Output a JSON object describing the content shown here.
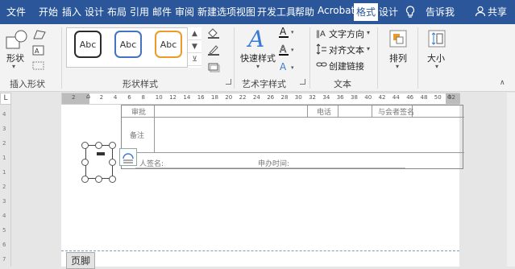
{
  "tabs": [
    "文件",
    "开始",
    "插入",
    "设计",
    "布局",
    "引用",
    "邮件",
    "审阅",
    "新建选项",
    "视图",
    "开发工具",
    "帮助",
    "Acrobat",
    "格式",
    "设计"
  ],
  "active_tab_index": 13,
  "tell_me": "告诉我",
  "share": "共享",
  "groups": {
    "insert_shapes": {
      "label": "插入形状",
      "shapes_btn": "形状"
    },
    "shape_styles": {
      "label": "形状样式",
      "sample": "Abc"
    },
    "wordart": {
      "label": "艺术字样式",
      "quick_styles": "快速样式"
    },
    "text": {
      "label": "文本",
      "direction": "文字方向",
      "align": "对齐文本",
      "link": "创建链接"
    },
    "arrange": {
      "label": "排列"
    },
    "size": {
      "label": "大小"
    }
  },
  "ruler_ticks": [
    "2",
    "",
    "2",
    "4",
    "6",
    "8",
    "10",
    "12",
    "14",
    "16",
    "18",
    "20",
    "22",
    "24",
    "26",
    "28",
    "30",
    "32",
    "34",
    "36",
    "38",
    "40",
    "42",
    "44",
    "46",
    "48",
    "50",
    "52"
  ],
  "vruler_ticks": [
    "4",
    "3",
    "2",
    "1",
    "1",
    "2",
    "3",
    "4",
    "5",
    "6",
    "7"
  ],
  "document": {
    "row1_left": "审批",
    "row1_mid": "电话",
    "row1_right": "与会者签名",
    "remark": "备注",
    "signer": "人签名:",
    "date": "申办时间:"
  },
  "footer_label": "页脚",
  "colors": {
    "accent": "#2b579a",
    "box1": "#2b2b2b",
    "box2": "#4472c4",
    "box3": "#ed9a2b"
  }
}
